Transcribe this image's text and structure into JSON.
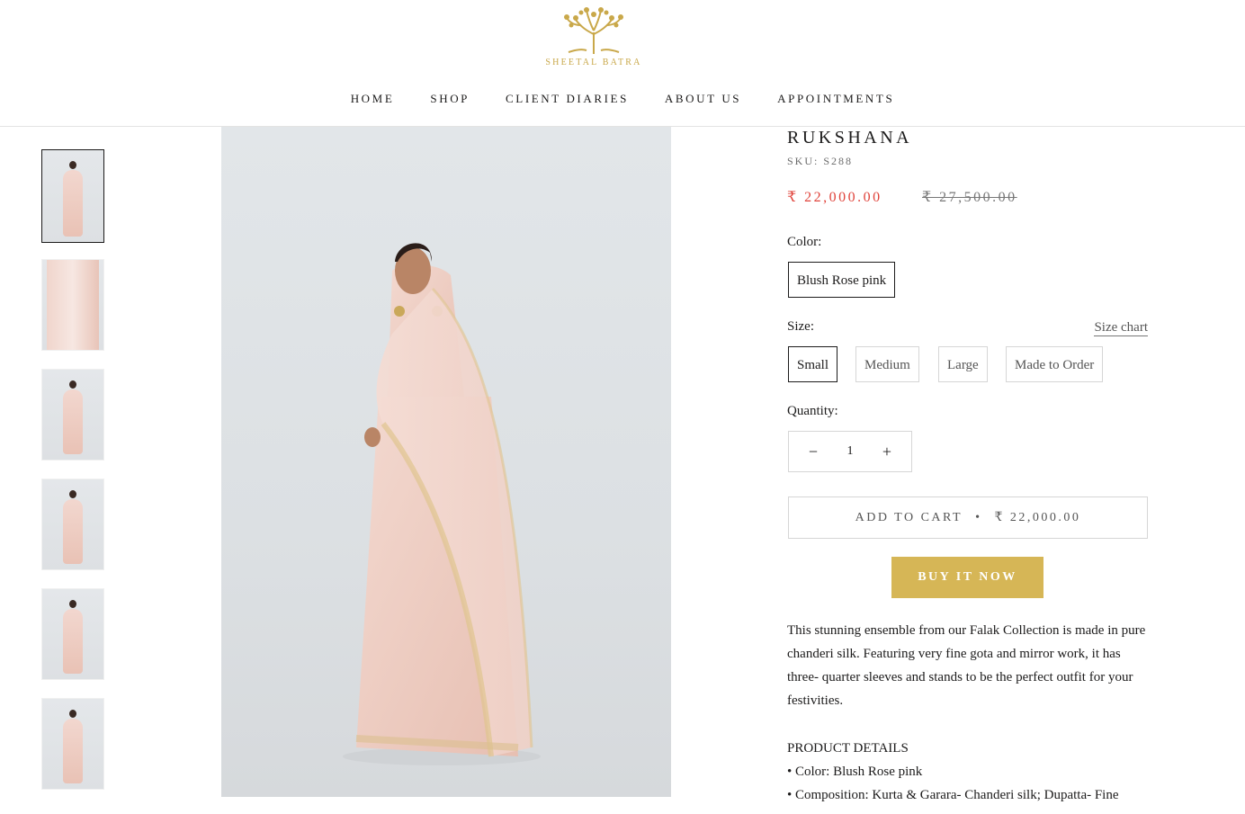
{
  "brand": {
    "name": "SHEETAL BATRA",
    "logo_icon": "tree-icon",
    "accent": "#c9a84a"
  },
  "nav": [
    "HOME",
    "SHOP",
    "CLIENT DIARIES",
    "ABOUT US",
    "APPOINTMENTS"
  ],
  "product": {
    "title": "RUKSHANA",
    "sku": "SKU: S288",
    "price": "₹ 22,000.00",
    "compare_price": "₹ 27,500.00",
    "color_label": "Color:",
    "colors": [
      "Blush Rose pink"
    ],
    "selected_color": "Blush Rose pink",
    "size_label": "Size:",
    "size_chart": "Size chart",
    "sizes": [
      "Small",
      "Medium",
      "Large",
      "Made to Order"
    ],
    "selected_size": "Small",
    "quantity_label": "Quantity:",
    "quantity": "1",
    "add_to_cart": "ADD TO CART",
    "add_to_cart_sep": "•",
    "add_to_cart_price": "₹ 22,000.00",
    "buy_now": "BUY IT NOW",
    "description": "This stunning ensemble from our Falak Collection is made in pure chanderi silk. Featuring very fine gota and mirror work, it has three- quarter sleeves and stands to be the perfect outfit for your festivities.",
    "details_heading": "PRODUCT DETAILS",
    "details": [
      "• Color: Blush Rose pink",
      "• Composition: Kurta & Garara- Chanderi silk; Dupatta- Fine"
    ]
  },
  "colors": {
    "sale_price": "#e0433b",
    "buy_button": "#d6b656",
    "text": "#1c1b1b"
  }
}
